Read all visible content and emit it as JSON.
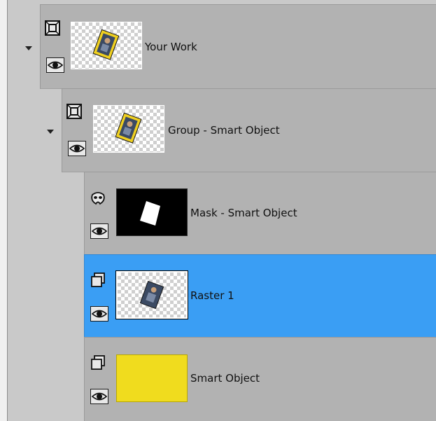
{
  "layers": [
    {
      "name": "Your Work",
      "type": "group",
      "selected": false
    },
    {
      "name": "Group - Smart Object",
      "type": "group",
      "selected": false
    },
    {
      "name": "Mask - Smart Object",
      "type": "mask",
      "selected": false
    },
    {
      "name": "Raster 1",
      "type": "raster",
      "selected": true
    },
    {
      "name": "Smart Object",
      "type": "raster",
      "selected": false
    }
  ],
  "colors": {
    "selection": "#3a9ef4",
    "row_bg": "#b2b2b2",
    "swatch_yellow": "#f0dc1e"
  },
  "icons": {
    "group": "group-frame-icon",
    "raster": "raster-layer-icon",
    "mask": "mask-icon",
    "visibility": "eye-icon",
    "expand": "triangle-down-icon"
  }
}
